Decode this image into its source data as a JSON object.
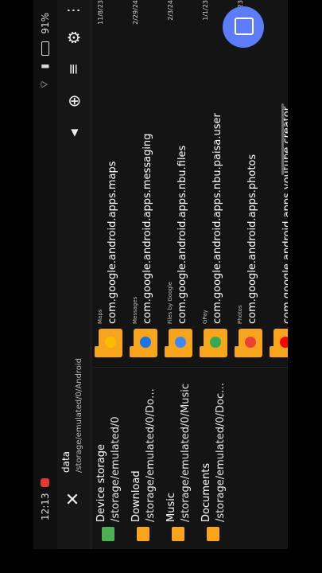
{
  "status": {
    "time": "12:13",
    "battery": "91%"
  },
  "toolbar": {
    "title": "data",
    "path": "/storage/emulated/0/Android"
  },
  "sidebar": {
    "items": [
      {
        "label": "Device storage",
        "path": "/storage/emulated/0",
        "icon": "device-storage-icon",
        "color": "#4caf50"
      },
      {
        "label": "Download",
        "path": "/storage/emulated/0/Do…",
        "icon": "download-folder-icon",
        "color": "#f7a51c"
      },
      {
        "label": "Music",
        "path": "/storage/emulated/0/Music",
        "icon": "music-folder-icon",
        "color": "#f7a51c"
      },
      {
        "label": "Documents",
        "path": "/storage/emulated/0/Doc…",
        "icon": "documents-folder-icon",
        "color": "#f7a51c"
      }
    ]
  },
  "files": [
    {
      "sub": "Maps",
      "name": "com.google.android.apps.maps",
      "date": "11/8/23",
      "badge": "#fbbc04"
    },
    {
      "sub": "Messages",
      "name": "com.google.android.apps.messaging",
      "date": "2/29/24",
      "badge": "#1a73e8"
    },
    {
      "sub": "Files by Google",
      "name": "com.google.android.apps.nbu.files",
      "date": "2/3/24",
      "badge": "#4285f4"
    },
    {
      "sub": "GPay",
      "name": "com.google.android.apps.nbu.paisa.user",
      "date": "1/1/23",
      "badge": "#34a853"
    },
    {
      "sub": "Photos",
      "name": "com.google.android.apps.photos",
      "date": "23",
      "badge": "#ea4335"
    },
    {
      "sub": "",
      "name": "com.google.android.apps.youtube.creator",
      "date": "",
      "badge": "#ff0000"
    }
  ]
}
